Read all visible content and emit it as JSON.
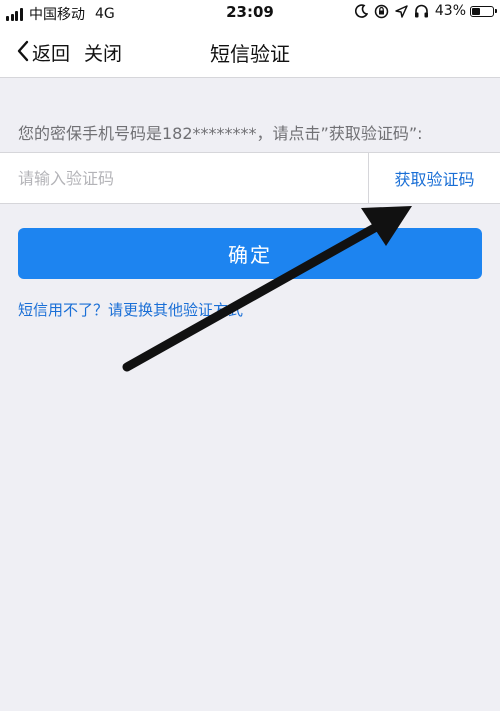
{
  "status_bar": {
    "carrier": "中国移动",
    "network": "4G",
    "time": "23:09",
    "battery_percent": "43%",
    "battery_level": 0.43,
    "icons": [
      "signal-bars-icon",
      "moon-icon",
      "orientation-lock-icon",
      "location-arrow-icon",
      "headphones-icon",
      "battery-icon"
    ]
  },
  "nav": {
    "back_label": "返回",
    "close_label": "关闭",
    "title": "短信验证"
  },
  "verify": {
    "hint": "您的密保手机号码是182********，请点击”获取验证码”:",
    "input_placeholder": "请输入验证码",
    "input_value": "",
    "get_code_label": "获取验证码",
    "confirm_label": "确定",
    "alt_link": "短信用不了？请更换其他验证方式"
  },
  "colors": {
    "primary": "#1d84f0",
    "link": "#1a6fd6",
    "background": "#efeff4"
  }
}
